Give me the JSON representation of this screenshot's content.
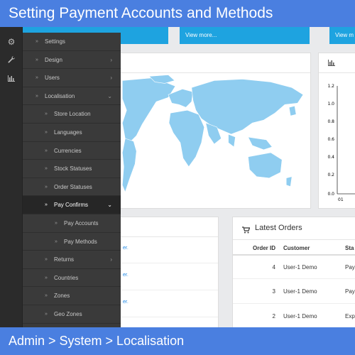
{
  "header": {
    "title": "Setting Payment Accounts and Methods"
  },
  "footer": {
    "breadcrumb": "Admin > System > Localisation"
  },
  "icon_rail": [
    {
      "icon": "gear-icon",
      "glyph": "⚙"
    },
    {
      "icon": "wrench-icon",
      "glyph": "🔧"
    },
    {
      "icon": "bar-chart-icon",
      "glyph": "📊"
    }
  ],
  "tiles": {
    "view_more_1": "View more...",
    "view_more_2": "View m"
  },
  "sidebar": {
    "items": [
      {
        "label": "Settings",
        "level": 1,
        "chevron": ""
      },
      {
        "label": "Design",
        "level": 1,
        "chevron": "›"
      },
      {
        "label": "Users",
        "level": 1,
        "chevron": "›"
      },
      {
        "label": "Localisation",
        "level": 1,
        "chevron": "⌄"
      },
      {
        "label": "Store Location",
        "level": 2,
        "chevron": ""
      },
      {
        "label": "Languages",
        "level": 2,
        "chevron": ""
      },
      {
        "label": "Currencies",
        "level": 2,
        "chevron": ""
      },
      {
        "label": "Stock Statuses",
        "level": 2,
        "chevron": ""
      },
      {
        "label": "Order Statuses",
        "level": 2,
        "chevron": ""
      },
      {
        "label": "Pay Confirms",
        "level": 2,
        "chevron": "⌄",
        "active": true
      },
      {
        "label": "Pay Accounts",
        "level": 3,
        "chevron": ""
      },
      {
        "label": "Pay Methods",
        "level": 3,
        "chevron": ""
      },
      {
        "label": "Returns",
        "level": 2,
        "chevron": "›"
      },
      {
        "label": "Countries",
        "level": 2,
        "chevron": ""
      },
      {
        "label": "Zones",
        "level": 2,
        "chevron": ""
      },
      {
        "label": "Geo Zones",
        "level": 2,
        "chevron": ""
      }
    ]
  },
  "chart_panel": {
    "y_ticks": [
      "1.2",
      "1.0",
      "0.8",
      "0.6",
      "0.4",
      "0.2",
      "0.0"
    ],
    "x_tick": "01"
  },
  "left_panel_links": [
    "er.",
    "er.",
    "er."
  ],
  "latest_orders": {
    "title": "Latest Orders",
    "columns": [
      "Order ID",
      "Customer",
      "Sta"
    ],
    "rows": [
      {
        "id": "4",
        "customer": "User-1 Demo",
        "status": "Pay"
      },
      {
        "id": "3",
        "customer": "User-1 Demo",
        "status": "Pay"
      },
      {
        "id": "2",
        "customer": "User-1 Demo",
        "status": "Exp"
      }
    ]
  },
  "colors": {
    "header_bar": "#4a7fe0",
    "sidebar": "#3a3a3a",
    "accent_tile": "#1ea3e0",
    "map_land": "#8fcdf0"
  }
}
